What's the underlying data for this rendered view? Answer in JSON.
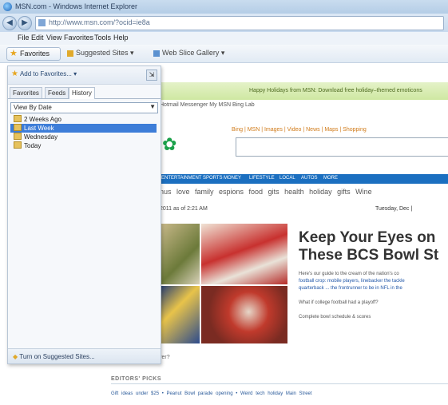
{
  "window": {
    "title": "MSN.com - Windows Internet Explorer"
  },
  "address": {
    "url": "http://www.msn.com/?ocid=ie8a"
  },
  "menu": [
    "File",
    "Edit",
    "View",
    "Favorites",
    "Tools",
    "Help"
  ],
  "favorites_bar": {
    "favorites_label": "Favorites",
    "suggested_sites": "Suggested Sites ▾",
    "web_slice": "Web Slice Gallery ▾"
  },
  "panel": {
    "add_to_favorites": "Add to Favorites... ▾",
    "tabs": [
      "Favorites",
      "Feeds",
      "History"
    ],
    "view_by": "View By Date",
    "history": [
      "2 Weeks Ago",
      "Last Week",
      "Wednesday",
      "Today"
    ],
    "selected_index": 1,
    "suggested": "Turn on Suggested Sites..."
  },
  "page": {
    "promo": "Happy Holidays from MSN: Download free holiday–themed emoticons",
    "msn_nav": "Hotmail  Messenger  My MSN  Bing  Lab",
    "links": "Bing | MSN | Images | Video | News | Maps | Shopping",
    "nav": [
      "ENTERTAINMENT",
      "SPORTS",
      "MONEY",
      "LIFESTYLE",
      "LOCAL",
      "AUTOS",
      "MORE"
    ],
    "trending": "nus  love  family  espions  food  gits  health  holiday gifts  Wine",
    "updated": "2011 as of 2:21 AM",
    "today": "Tuesday, Dec |",
    "headline1": "Keep Your Eyes on",
    "headline2": "These BCS Bowl St",
    "blurb1": "Here's our guide to the cream of the nation's co",
    "blurb2": "football crop: mobile players, linebacker the tackle",
    "blurb3": "quarterback ... the frontrunner to be in NFL in the",
    "blurb4": "What if college football had a playoff?",
    "blurb5": "Complete bowl schedule & scores",
    "question": "ver?",
    "editors_picks": "EDITORS' PICKS",
    "picks": "Gift ideas under $25    •  Peanut Bowl parade opening    •  Weird tech holiday Main Street"
  },
  "colors": {
    "accent": "#1b6fc0",
    "selected": "#3d7dd8",
    "promo": "#cfe8a2"
  }
}
